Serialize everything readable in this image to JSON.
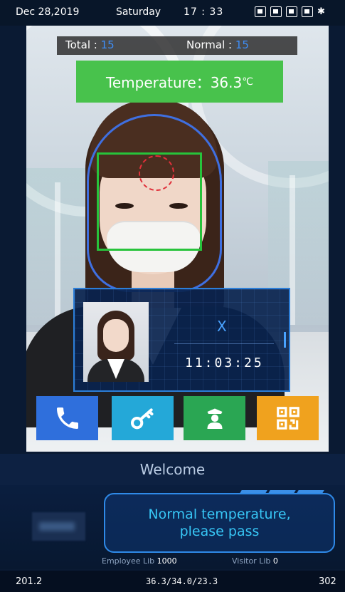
{
  "status_bar": {
    "date": "Dec 28,2019",
    "weekday": "Saturday",
    "time": "17 : 33",
    "icons": [
      "face-mode-icon",
      "id-card-icon",
      "sd-card-icon",
      "usb-icon",
      "bluetooth-icon"
    ]
  },
  "counters": {
    "total_label": "Total :",
    "total_value": "15",
    "normal_label": "Normal :",
    "normal_value": "15"
  },
  "temperature": {
    "label": "Temperature：36.3",
    "unit": "℃"
  },
  "match": {
    "close_label": "X",
    "time": "11:03:25"
  },
  "actions": [
    {
      "name": "call",
      "icon": "phone-icon",
      "color": "#2f6fdc"
    },
    {
      "name": "unlock",
      "icon": "key-icon",
      "color": "#24a8d8"
    },
    {
      "name": "guard",
      "icon": "guard-icon",
      "color": "#2aa653"
    },
    {
      "name": "qr",
      "icon": "qr-code-icon",
      "color": "#f0a21e"
    }
  ],
  "welcome": "Welcome",
  "message": {
    "line1": "Normal temperature,",
    "line2": "please pass"
  },
  "libraries": {
    "employee_label": "Employee Lib",
    "employee_count": "1000",
    "visitor_label": "Visitor Lib",
    "visitor_count": "0"
  },
  "footer": {
    "ip": "201.2",
    "readings": "36.3/34.0/23.3",
    "code": "302"
  }
}
